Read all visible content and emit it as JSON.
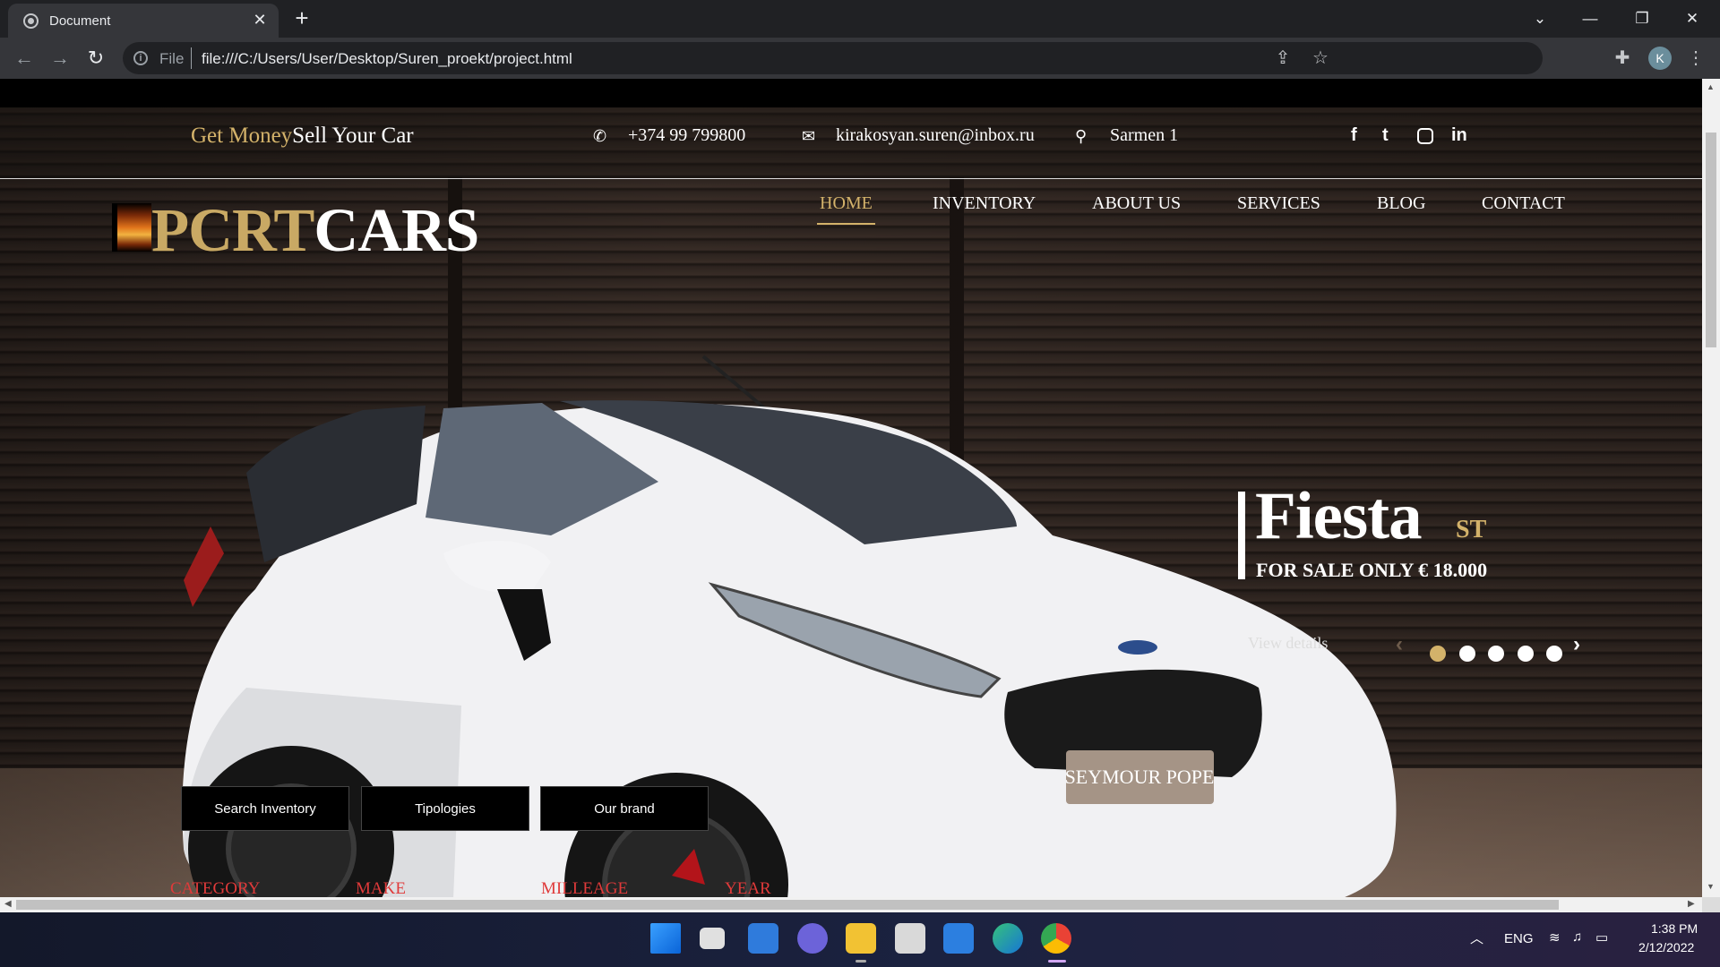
{
  "browser": {
    "tab_title": "Document",
    "tab_close_glyph": "✕",
    "new_tab_glyph": "+",
    "scheme_label": "File",
    "url": "file:///C:/Users/User/Desktop/Suren_proekt/project.html",
    "profile_initial": "K",
    "icons": [
      "globe-icon",
      "back-icon",
      "forward-icon",
      "reload-icon",
      "info-icon",
      "share-icon",
      "star-icon",
      "extensions-icon",
      "menu-icon"
    ]
  },
  "site": {
    "tagline_gold": "Get Money",
    "tagline_white": "Sell Your Car",
    "phone": "+374 99 799800",
    "email": "kirakosyan.suren@inbox.ru",
    "address": "Sarmen 1",
    "social": [
      "facebook-icon",
      "twitter-icon",
      "instagram-icon",
      "linkedin-icon"
    ],
    "logo_gold": "PCRT",
    "logo_white": "CARS",
    "nav": [
      "HOME",
      "INVENTORY",
      "ABOUT US",
      "SERVICES",
      "BLOG",
      "CONTACT"
    ],
    "active_nav": "HOME",
    "slide": {
      "title": "Fiesta",
      "subtitle": "ST",
      "price": "FOR SALE ONLY € 18.000",
      "link": "View details",
      "total_slides": 5,
      "active_slide": 1
    },
    "buttons": [
      "Search Inventory",
      "Tipologies",
      "Our brand"
    ],
    "filters": [
      "CATEGORY",
      "MAKE",
      "MILLEAGE",
      "YEAR"
    ],
    "plate_text": "SEYMOUR POPE",
    "colors": {
      "gold": "#d3b26a",
      "filter_red": "#e03a3a"
    }
  },
  "taskbar": {
    "lang": "ENG",
    "time": "1:38 PM",
    "date": "2/12/2022"
  }
}
